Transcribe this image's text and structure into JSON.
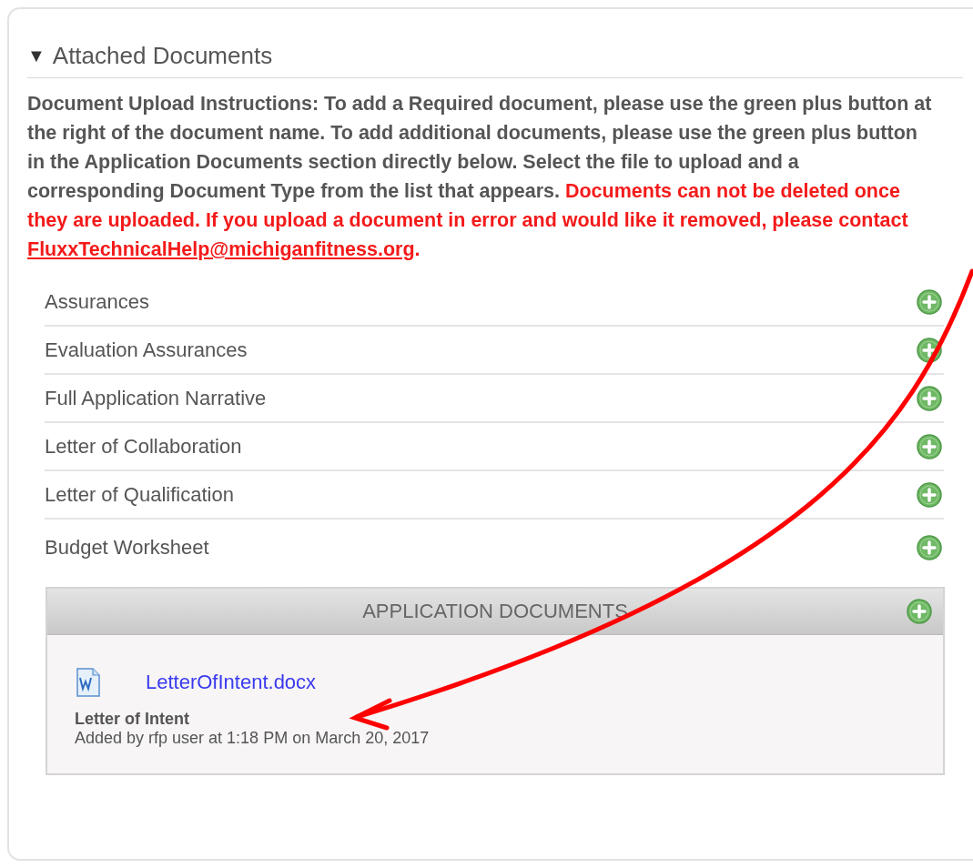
{
  "section": {
    "title": "Attached Documents",
    "toggle": "▼",
    "expanded": true
  },
  "instructions": {
    "text": "Document Upload Instructions: To add a Required document, please use the green plus button at the right of the document name. To add additional documents, please use the green plus button in the Application Documents section directly below. Select the file to upload and a corresponding Document Type from the list that appears.",
    "warning": "Documents can not be deleted once they are uploaded. If you upload a document in error and would like it removed, please contact",
    "email": "FluxxTechnicalHelp@michiganfitness.org",
    "end": "."
  },
  "required_documents": [
    {
      "name": "Assurances"
    },
    {
      "name": "Evaluation Assurances"
    },
    {
      "name": "Full Application Narrative"
    },
    {
      "name": "Letter of Collaboration"
    },
    {
      "name": "Letter of Qualification"
    },
    {
      "name": "Budget Worksheet"
    }
  ],
  "application_documents": {
    "title": "APPLICATION DOCUMENTS",
    "files": [
      {
        "file_name": "LetterOfIntent.docx",
        "type": "Letter of Intent",
        "added": "Added by rfp user at 1:18 PM on March 20, 2017"
      }
    ]
  }
}
